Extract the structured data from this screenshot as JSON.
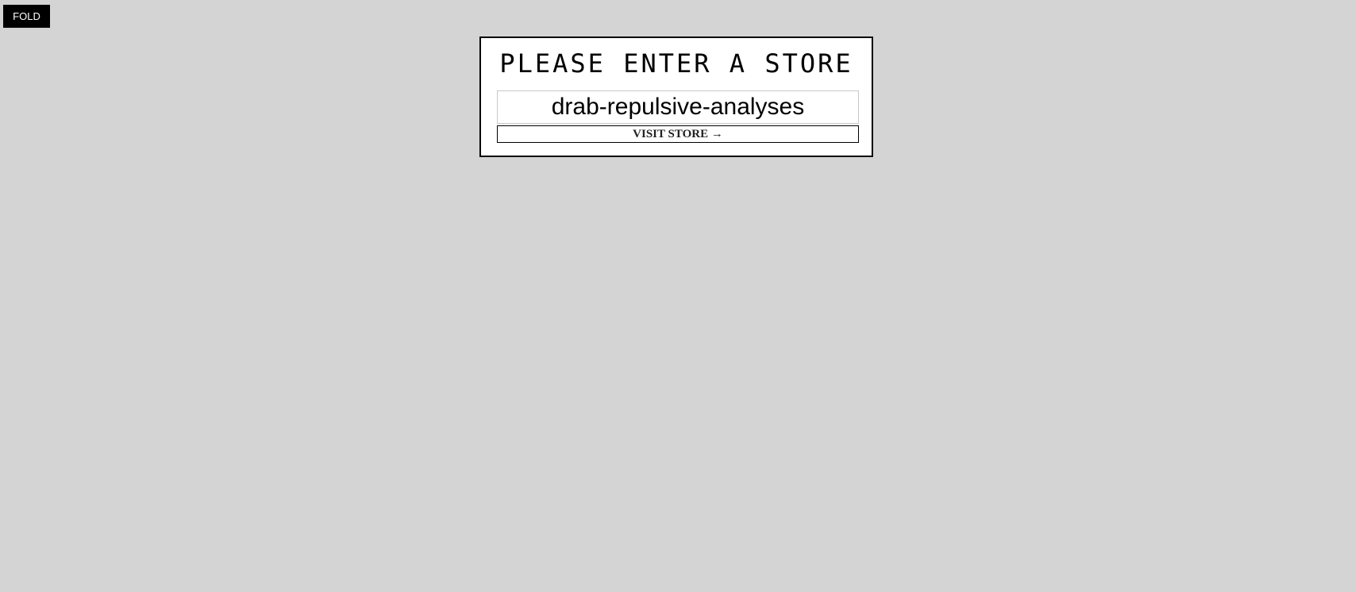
{
  "fold_button": {
    "label": "FOLD"
  },
  "store_prompt": {
    "title": "Please enter a store",
    "input_value": "drab-repulsive-analyses",
    "submit_label": "VISIT STORE →"
  },
  "colors": {
    "background": "#d4d4d4",
    "card": "#ffffff",
    "border": "#000000",
    "fold_button_bg": "#000000",
    "fold_button_text": "#ffffff"
  }
}
